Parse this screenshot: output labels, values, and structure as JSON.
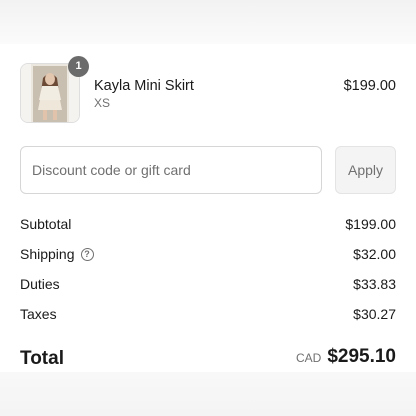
{
  "line_item": {
    "quantity": "1",
    "name": "Kayla Mini Skirt",
    "variant": "XS",
    "price": "$199.00",
    "image_icon": "product-photo"
  },
  "discount": {
    "placeholder": "Discount code or gift card",
    "value": "",
    "apply_label": "Apply"
  },
  "summary": {
    "subtotal_label": "Subtotal",
    "subtotal_value": "$199.00",
    "shipping_label": "Shipping",
    "shipping_help_icon": "question-circle-icon",
    "shipping_value": "$32.00",
    "duties_label": "Duties",
    "duties_value": "$33.83",
    "taxes_label": "Taxes",
    "taxes_value": "$30.27"
  },
  "total": {
    "label": "Total",
    "currency": "CAD",
    "value": "$295.10"
  },
  "colors": {
    "text": "#1a1a1a",
    "muted": "#707070",
    "badge": "#6b6b6b",
    "border": "#d6d6d6"
  }
}
